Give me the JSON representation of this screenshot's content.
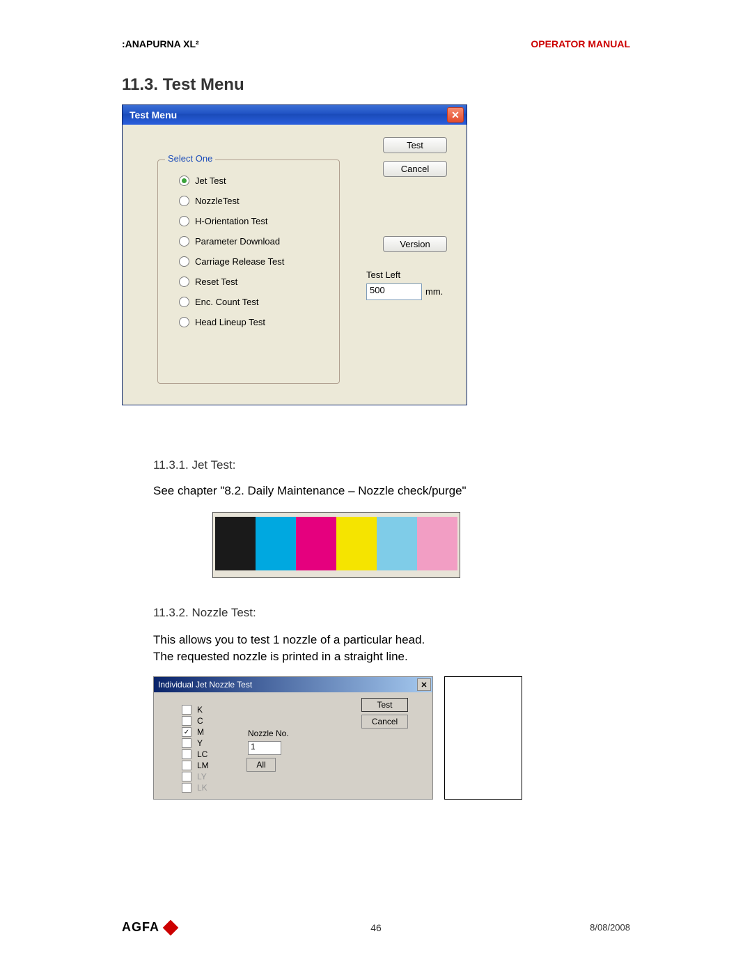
{
  "header": {
    "left": ":ANAPURNA XL²",
    "right": "OPERATOR MANUAL"
  },
  "section_title": "11.3. Test Menu",
  "dialog1": {
    "title": "Test Menu",
    "legend": "Select One",
    "radios": [
      {
        "label": "Jet Test",
        "selected": true
      },
      {
        "label": "NozzleTest",
        "selected": false
      },
      {
        "label": "H-Orientation Test",
        "selected": false
      },
      {
        "label": "Parameter Download",
        "selected": false
      },
      {
        "label": "Carriage Release Test",
        "selected": false
      },
      {
        "label": "Reset Test",
        "selected": false
      },
      {
        "label": "Enc. Count Test",
        "selected": false
      },
      {
        "label": "Head Lineup Test",
        "selected": false
      }
    ],
    "buttons": {
      "test": "Test",
      "cancel": "Cancel",
      "version": "Version"
    },
    "test_left_label": "Test Left",
    "test_left_value": "500",
    "mm": "mm."
  },
  "sub1": {
    "title": "11.3.1. Jet Test:",
    "text": "See chapter \"8.2. Daily Maintenance – Nozzle check/purge\""
  },
  "color_strip": [
    "#1a1a1a",
    "#00a8e0",
    "#e5007e",
    "#f5e400",
    "#7fcce8",
    "#f29ec4"
  ],
  "sub2": {
    "title": "11.3.2. Nozzle Test:",
    "line1": "This allows you to test 1 nozzle of a particular head.",
    "line2": "The requested nozzle is printed in a straight line."
  },
  "dialog2": {
    "title": "Individual Jet Nozzle Test",
    "checks": [
      {
        "label": "K",
        "checked": false,
        "disabled": false
      },
      {
        "label": "C",
        "checked": false,
        "disabled": false
      },
      {
        "label": "M",
        "checked": true,
        "disabled": false
      },
      {
        "label": "Y",
        "checked": false,
        "disabled": false
      },
      {
        "label": "LC",
        "checked": false,
        "disabled": false
      },
      {
        "label": "LM",
        "checked": false,
        "disabled": false
      },
      {
        "label": "LY",
        "checked": false,
        "disabled": true
      },
      {
        "label": "LK",
        "checked": false,
        "disabled": true
      }
    ],
    "nozzle_label": "Nozzle No.",
    "nozzle_value": "1",
    "all": "All",
    "test": "Test",
    "cancel": "Cancel"
  },
  "footer": {
    "logo": "AGFA",
    "page": "46",
    "date": "8/08/2008"
  }
}
